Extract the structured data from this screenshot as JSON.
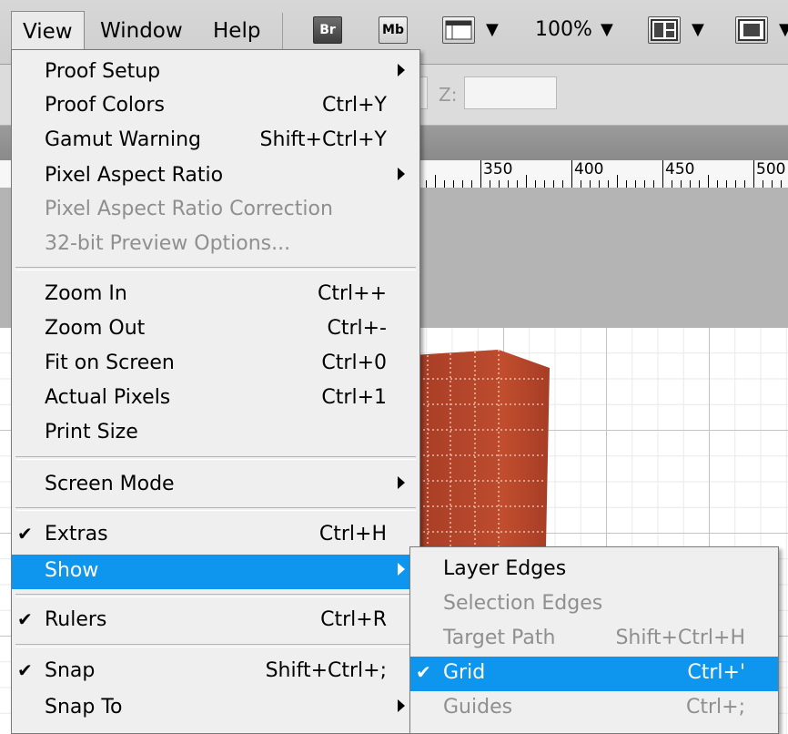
{
  "menubar": {
    "view": "View",
    "window": "Window",
    "help": "Help",
    "br_label": "Br",
    "mb_label": "Mb",
    "zoom": "100%"
  },
  "options": {
    "z_label": "Z:"
  },
  "ruler": {
    "ticks": [
      "350",
      "400",
      "450",
      "500"
    ]
  },
  "view_menu": {
    "items": [
      {
        "label": "Proof Setup",
        "shortcut": "",
        "submenu": true
      },
      {
        "label": "Proof Colors",
        "shortcut": "Ctrl+Y"
      },
      {
        "label": "Gamut Warning",
        "shortcut": "Shift+Ctrl+Y"
      },
      {
        "label": "Pixel Aspect Ratio",
        "shortcut": "",
        "submenu": true
      },
      {
        "label": "Pixel Aspect Ratio Correction",
        "shortcut": "",
        "disabled": true
      },
      {
        "label": "32-bit Preview Options...",
        "shortcut": "",
        "disabled": true
      },
      {
        "label": "Zoom In",
        "shortcut": "Ctrl++"
      },
      {
        "label": "Zoom Out",
        "shortcut": "Ctrl+-"
      },
      {
        "label": "Fit on Screen",
        "shortcut": "Ctrl+0"
      },
      {
        "label": "Actual Pixels",
        "shortcut": "Ctrl+1"
      },
      {
        "label": "Print Size",
        "shortcut": ""
      },
      {
        "label": "Screen Mode",
        "shortcut": "",
        "submenu": true
      },
      {
        "label": "Extras",
        "shortcut": "Ctrl+H",
        "checked": true
      },
      {
        "label": "Show",
        "shortcut": "",
        "submenu": true,
        "highlighted": true
      },
      {
        "label": "Rulers",
        "shortcut": "Ctrl+R",
        "checked": true
      },
      {
        "label": "Snap",
        "shortcut": "Shift+Ctrl+;",
        "checked": true
      },
      {
        "label": "Snap To",
        "shortcut": "",
        "submenu": true
      }
    ]
  },
  "show_menu": {
    "items": [
      {
        "label": "Layer Edges",
        "shortcut": ""
      },
      {
        "label": "Selection Edges",
        "shortcut": "",
        "disabled": true
      },
      {
        "label": "Target Path",
        "shortcut": "Shift+Ctrl+H",
        "disabled": true
      },
      {
        "label": "Grid",
        "shortcut": "Ctrl+'",
        "checked": true,
        "highlighted": true
      },
      {
        "label": "Guides",
        "shortcut": "Ctrl+;",
        "disabled": true
      }
    ]
  },
  "colors": {
    "highlight": "#0e95ee",
    "building": "#b5432a"
  }
}
